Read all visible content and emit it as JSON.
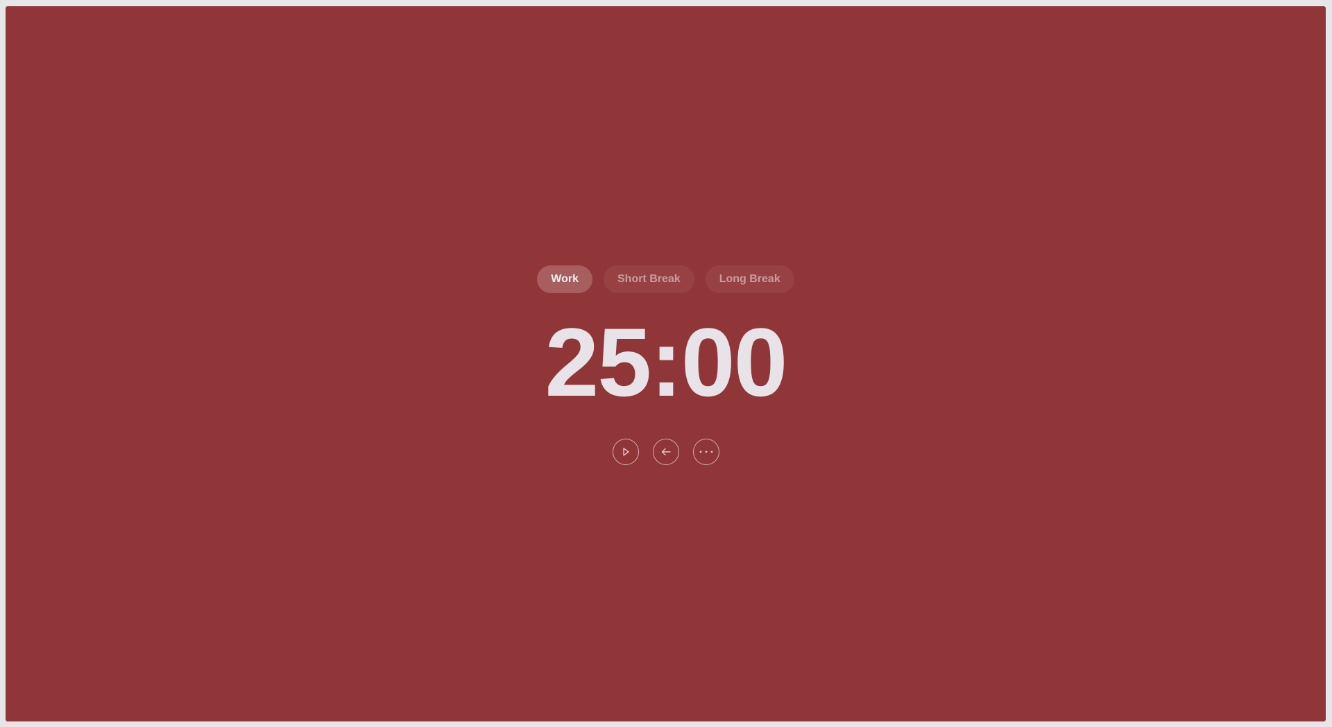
{
  "colors": {
    "background": "#913638",
    "window_frame": "#e6e6e8",
    "active_pill": "rgba(255,255,255,0.20)",
    "text": "#e7e3e8"
  },
  "modes": [
    {
      "label": "Work",
      "active": true
    },
    {
      "label": "Short Break",
      "active": false
    },
    {
      "label": "Long Break",
      "active": false
    }
  ],
  "timer": {
    "display": "25:00"
  },
  "controls": [
    {
      "icon": "play-icon"
    },
    {
      "icon": "arrow-left-icon"
    },
    {
      "icon": "more-icon"
    }
  ]
}
